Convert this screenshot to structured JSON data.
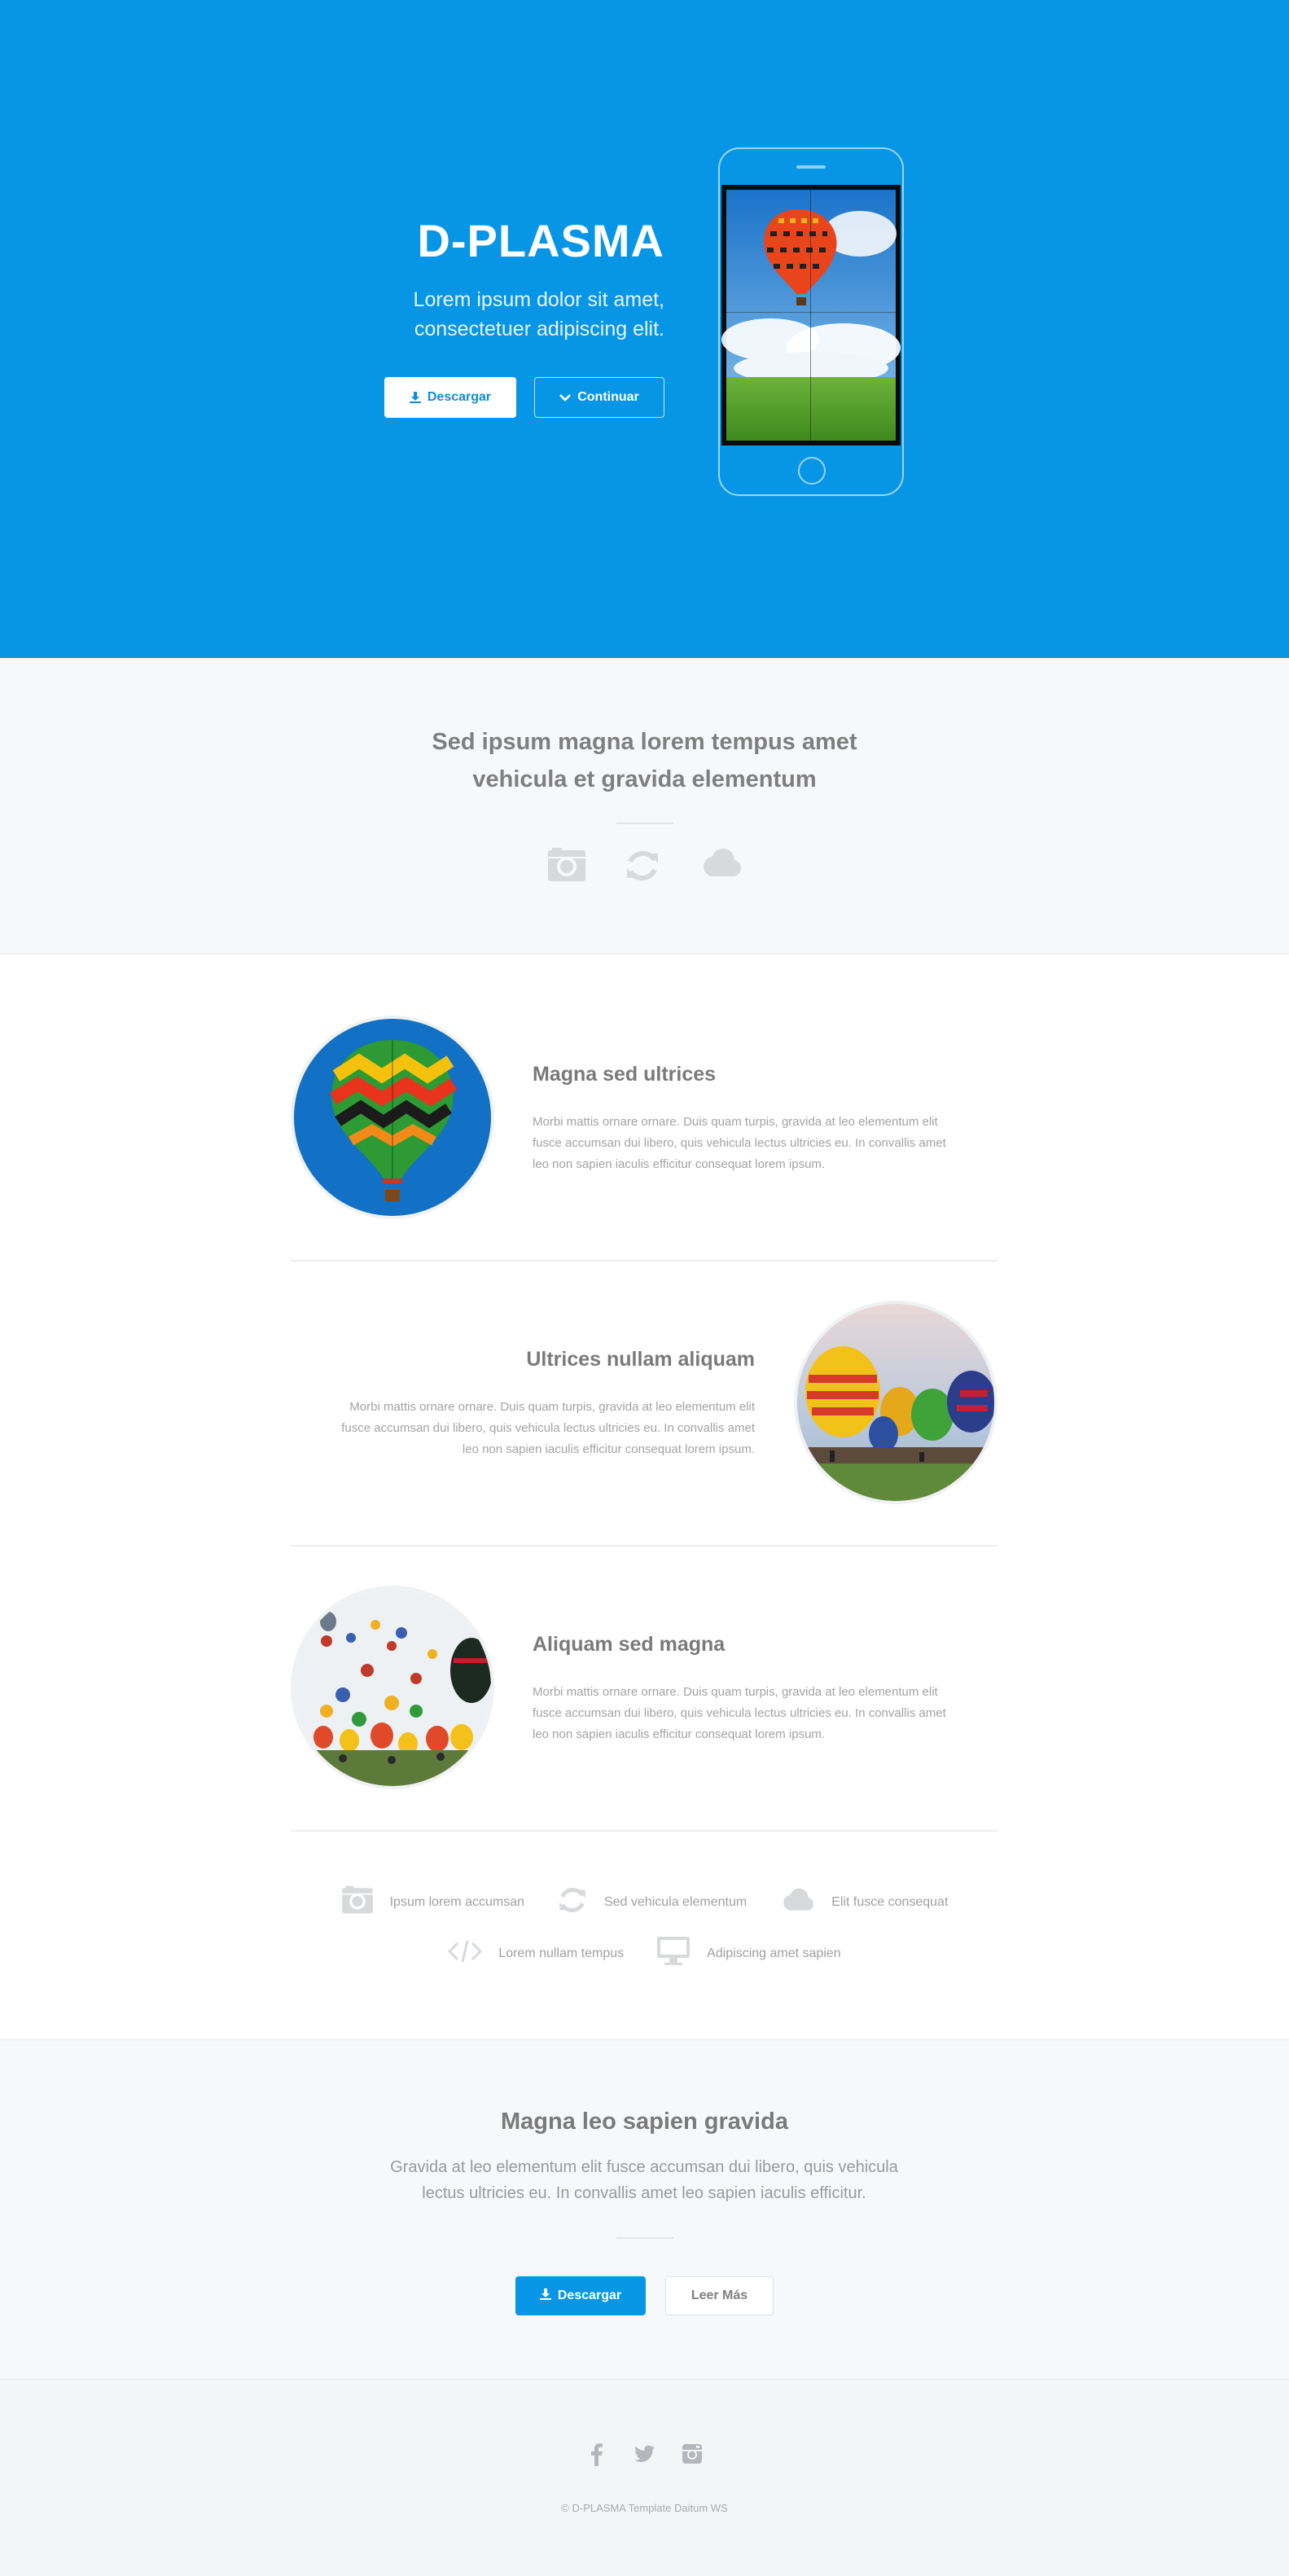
{
  "hero": {
    "title": "D-PLASMA",
    "subtitle_line1": "Lorem ipsum dolor sit amet,",
    "subtitle_line2": "consectetuer adipiscing elit.",
    "download_label": "Descargar",
    "continue_label": "Continuar"
  },
  "intro": {
    "line1": "Sed ipsum magna lorem tempus amet",
    "line2": "vehicula et gravida elementum",
    "icons": [
      "camera-icon",
      "refresh-icon",
      "cloud-icon"
    ]
  },
  "features": [
    {
      "title": "Magna sed ultrices",
      "body_lines": [
        "Morbi mattis ornare ornare. Duis quam turpis, gravida at leo elementum elit",
        "fusce accumsan dui libero, quis vehicula lectus ultricies eu. In convallis amet",
        "leo non sapien iaculis efficitur consequat lorem ipsum."
      ]
    },
    {
      "title": "Ultrices nullam aliquam",
      "body_lines": [
        "Morbi mattis ornare ornare. Duis quam turpis, gravida at leo elementum elit",
        "fusce accumsan dui libero, quis vehicula lectus ultricies eu. In convallis amet",
        "leo non sapien iaculis efficitur consequat lorem ipsum."
      ]
    },
    {
      "title": "Aliquam sed magna",
      "body_lines": [
        "Morbi mattis ornare ornare. Duis quam turpis, gravida at leo elementum elit",
        "fusce accumsan dui libero, quis vehicula lectus ultricies eu. In convallis amet",
        "leo non sapien iaculis efficitur consequat lorem ipsum."
      ]
    }
  ],
  "mini_features": [
    {
      "icon": "camera-icon",
      "label": "Ipsum lorem accumsan"
    },
    {
      "icon": "refresh-icon",
      "label": "Sed vehicula elementum"
    },
    {
      "icon": "cloud-icon",
      "label": "Elit fusce consequat"
    },
    {
      "icon": "code-icon",
      "label": "Lorem nullam tempus"
    },
    {
      "icon": "desktop-icon",
      "label": "Adipiscing amet sapien"
    }
  ],
  "cta": {
    "title": "Magna leo sapien gravida",
    "body_line1": "Gravida at leo elementum elit fusce accumsan dui libero, quis vehicula",
    "body_line2": "lectus ultricies eu. In convallis amet leo sapien iaculis efficitur.",
    "download_label": "Descargar",
    "more_label": "Leer Más"
  },
  "footer": {
    "social": [
      "facebook-icon",
      "twitter-icon",
      "instagram-icon"
    ],
    "copyright": "© D-PLASMA Template Daitum WS"
  },
  "colors": {
    "accent": "#0796e6",
    "band": "#f7f8f9",
    "footer": "#f4f5f6",
    "icon_gray": "#d7d9db"
  }
}
